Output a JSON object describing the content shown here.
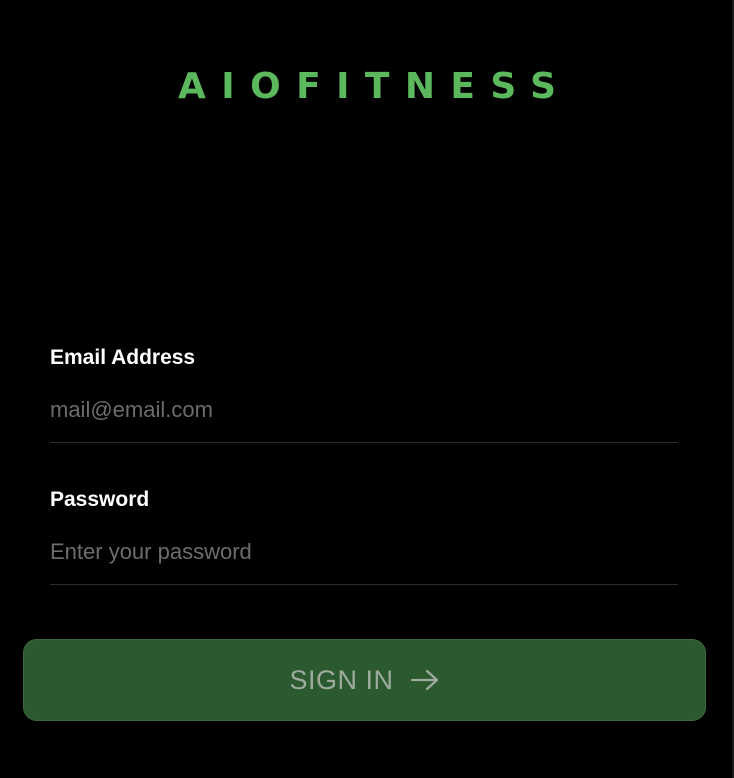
{
  "app": {
    "logo_text": "AIOFITNESS",
    "brand_color": "#5cb85c"
  },
  "form": {
    "email": {
      "label": "Email Address",
      "value": "",
      "placeholder": "mail@email.com"
    },
    "password": {
      "label": "Password",
      "value": "",
      "placeholder": "Enter your password"
    }
  },
  "signin_button": {
    "label": "SIGN IN",
    "icon": "arrow-right-icon",
    "background": "#2c5a30"
  },
  "colors": {
    "background": "#000000",
    "label": "#ffffff",
    "placeholder": "#6c6c6c",
    "divider": "#2b2b2b"
  }
}
